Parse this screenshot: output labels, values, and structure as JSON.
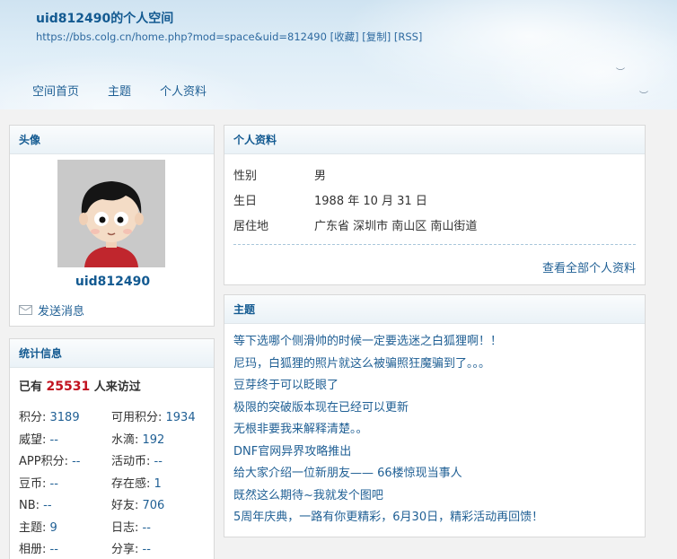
{
  "header": {
    "title": "uid812490的个人空间",
    "url": "https://bbs.colg.cn/home.php?mod=space&uid=812490",
    "links": [
      "[收藏]",
      "[复制]",
      "[RSS]"
    ],
    "nav": [
      "空间首页",
      "主题",
      "个人资料"
    ]
  },
  "avatar_panel": {
    "title": "头像",
    "username": "uid812490",
    "send_message": "发送消息"
  },
  "stats_panel": {
    "title": "统计信息",
    "visits_prefix": "已有",
    "visits_count": "25531",
    "visits_suffix": "人来访过",
    "rows": [
      [
        {
          "label": "积分: ",
          "value": "3189"
        },
        {
          "label": "可用积分: ",
          "value": "1934"
        }
      ],
      [
        {
          "label": "威望: ",
          "value": "--"
        },
        {
          "label": "水滴: ",
          "value": "192"
        }
      ],
      [
        {
          "label": "APP积分: ",
          "value": "--"
        },
        {
          "label": "活动币: ",
          "value": "--"
        }
      ],
      [
        {
          "label": "豆币: ",
          "value": "--"
        },
        {
          "label": "存在感: ",
          "value": "1"
        }
      ],
      [
        {
          "label": "NB: ",
          "value": "--"
        },
        {
          "label": "好友: ",
          "value": "706"
        }
      ],
      [
        {
          "label": "主题: ",
          "value": "9"
        },
        {
          "label": "日志: ",
          "value": "--"
        }
      ],
      [
        {
          "label": "相册: ",
          "value": "--"
        },
        {
          "label": "分享: ",
          "value": "--"
        }
      ]
    ]
  },
  "profile_panel": {
    "title": "个人资料",
    "fields": [
      {
        "label": "性别",
        "value": "男"
      },
      {
        "label": "生日",
        "value": "1988 年 10 月 31 日"
      },
      {
        "label": "居住地",
        "value": "广东省 深圳市 南山区 南山街道"
      }
    ],
    "view_all": "查看全部个人资料"
  },
  "threads_panel": {
    "title": "主题",
    "items": [
      "等下选哪个侧滑帅的时候一定要选迷之白狐狸啊！！",
      "尼玛，白狐狸的照片就这么被骗照狂魔骗到了。。。",
      "豆芽终于可以眨眼了",
      "极限的突破版本现在已经可以更新",
      "无根非要我来解释清楚。。",
      "DNF官网异界攻略推出",
      "给大家介绍一位新朋友—— 66楼惊现当事人",
      "既然这么期待~我就发个图吧",
      "5周年庆典，一路有你更精彩，6月30日，精彩活动再回馈！"
    ]
  },
  "colors": {
    "link": "#1f5f94",
    "title": "#135a91",
    "visits_number": "#c1121f"
  }
}
